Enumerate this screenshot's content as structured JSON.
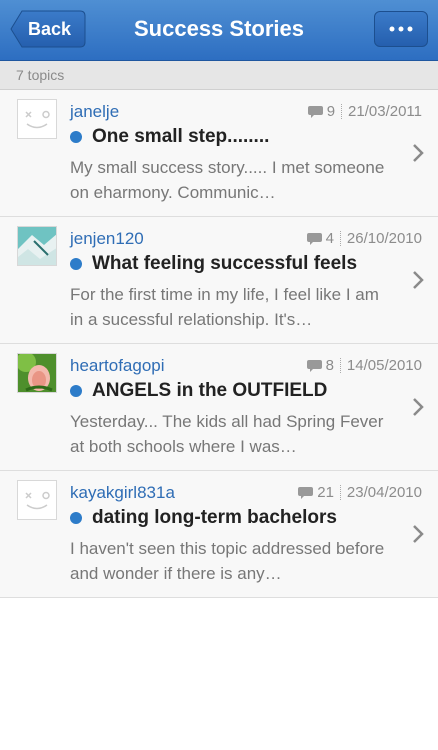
{
  "nav": {
    "back_label": "Back",
    "title": "Success Stories",
    "more_icon": "ellipsis-icon"
  },
  "subheader": {
    "count_label": "7 topics"
  },
  "topics": [
    {
      "username": "janelje",
      "replies": "9",
      "date": "21/03/2011",
      "title": "One small step........",
      "excerpt": "My small success story..... I met someone on eharmony. Communic…",
      "avatar": "placeholder"
    },
    {
      "username": "jenjen120",
      "replies": "4",
      "date": "26/10/2010",
      "title": "What feeling successful feels",
      "excerpt": "For the first time in my life, I feel like I am in a sucessful relationship. It's…",
      "avatar": "photo-teal"
    },
    {
      "username": "heartofagopi",
      "replies": "8",
      "date": "14/05/2010",
      "title": "ANGELS in the OUTFIELD",
      "excerpt": "Yesterday... The kids all had Spring Fever at both schools where I was…",
      "avatar": "photo-flower"
    },
    {
      "username": "kayakgirl831a",
      "replies": "21",
      "date": "23/04/2010",
      "title": "dating long-term bachelors",
      "excerpt": "I haven't seen this topic addressed before and wonder if there is any…",
      "avatar": "placeholder"
    }
  ],
  "colors": {
    "nav": "#2d6ec1",
    "link": "#2f6db5",
    "unread_dot": "#2d7cc9"
  }
}
